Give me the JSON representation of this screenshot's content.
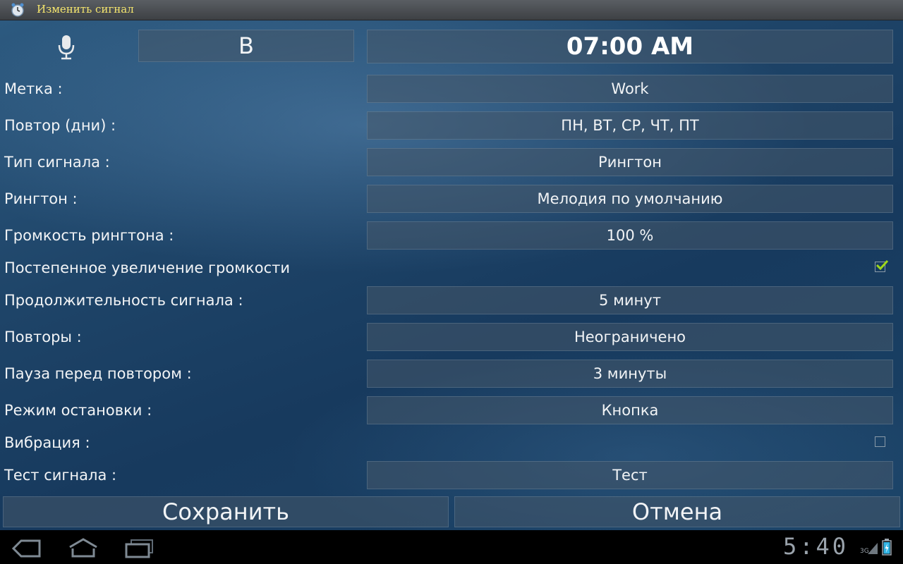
{
  "window": {
    "title": "Изменить сигнал",
    "app_icon": "alarm-clock-icon"
  },
  "header": {
    "mic_icon": "microphone-icon",
    "b_label": "В",
    "time": "07:00 AM"
  },
  "rows": [
    {
      "label": "Метка :",
      "value": "Work"
    },
    {
      "label": "Повтор (дни) :",
      "value": "ПН, ВТ, СР, ЧТ, ПТ"
    },
    {
      "label": "Тип сигнала :",
      "value": "Рингтон"
    },
    {
      "label": "Рингтон :",
      "value": "Мелодия по умолчанию"
    },
    {
      "label": "Громкость рингтона :",
      "value": "100 %"
    },
    {
      "label": "Постепенное увеличение громкости",
      "checked": true
    },
    {
      "label": "Продолжительность сигнала :",
      "value": "5 минут"
    },
    {
      "label": "Повторы :",
      "value": "Неограничено"
    },
    {
      "label": "Пауза перед повтором :",
      "value": "3 минуты"
    },
    {
      "label": "Режим остановки :",
      "value": "Кнопка"
    },
    {
      "label": "Вибрация :",
      "checked": false
    },
    {
      "label": "Тест сигнала :",
      "value": "Тест"
    }
  ],
  "buttons": {
    "save": "Сохранить",
    "cancel": "Отмена"
  },
  "navbar": {
    "back_icon": "back-icon",
    "home_icon": "home-icon",
    "recents_icon": "recent-apps-icon",
    "clock": "5:40",
    "network": "3G",
    "signal_icon": "signal-icon",
    "battery_icon": "battery-charging-icon"
  },
  "colors": {
    "title_text": "#f4e56e",
    "check": "#9fd81a",
    "background": "#1e4468"
  }
}
